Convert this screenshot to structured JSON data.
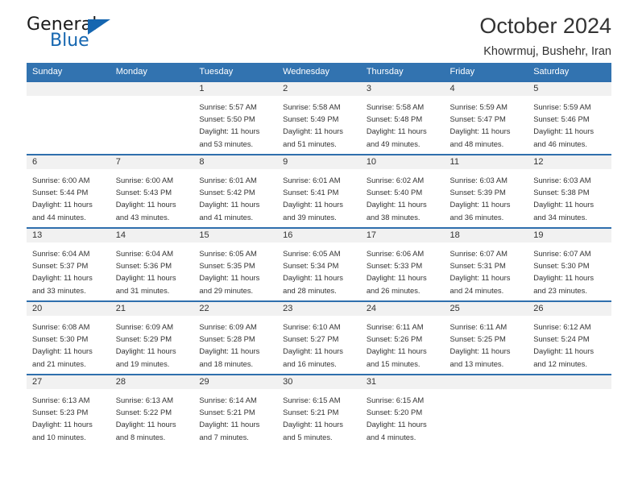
{
  "brand": {
    "name_top": "General",
    "name_bottom": "Blue",
    "triangle_color": "#1566b0"
  },
  "header": {
    "title": "October 2024",
    "subtitle": "Khowrmuj, Bushehr, Iran"
  },
  "theme": {
    "header_blue": "#3273b0",
    "row_border": "#2f6fad",
    "daynum_band": "#f1f1f1",
    "text": "#333333"
  },
  "calendar": {
    "weekday_headers": [
      "Sunday",
      "Monday",
      "Tuesday",
      "Wednesday",
      "Thursday",
      "Friday",
      "Saturday"
    ],
    "weeks": [
      [
        {
          "day": "",
          "sunrise": "",
          "sunset": "",
          "daylight1": "",
          "daylight2": "",
          "empty": true
        },
        {
          "day": "",
          "sunrise": "",
          "sunset": "",
          "daylight1": "",
          "daylight2": "",
          "empty": true
        },
        {
          "day": "1",
          "sunrise": "Sunrise: 5:57 AM",
          "sunset": "Sunset: 5:50 PM",
          "daylight1": "Daylight: 11 hours",
          "daylight2": "and 53 minutes.",
          "empty": false
        },
        {
          "day": "2",
          "sunrise": "Sunrise: 5:58 AM",
          "sunset": "Sunset: 5:49 PM",
          "daylight1": "Daylight: 11 hours",
          "daylight2": "and 51 minutes.",
          "empty": false
        },
        {
          "day": "3",
          "sunrise": "Sunrise: 5:58 AM",
          "sunset": "Sunset: 5:48 PM",
          "daylight1": "Daylight: 11 hours",
          "daylight2": "and 49 minutes.",
          "empty": false
        },
        {
          "day": "4",
          "sunrise": "Sunrise: 5:59 AM",
          "sunset": "Sunset: 5:47 PM",
          "daylight1": "Daylight: 11 hours",
          "daylight2": "and 48 minutes.",
          "empty": false
        },
        {
          "day": "5",
          "sunrise": "Sunrise: 5:59 AM",
          "sunset": "Sunset: 5:46 PM",
          "daylight1": "Daylight: 11 hours",
          "daylight2": "and 46 minutes.",
          "empty": false
        }
      ],
      [
        {
          "day": "6",
          "sunrise": "Sunrise: 6:00 AM",
          "sunset": "Sunset: 5:44 PM",
          "daylight1": "Daylight: 11 hours",
          "daylight2": "and 44 minutes.",
          "empty": false
        },
        {
          "day": "7",
          "sunrise": "Sunrise: 6:00 AM",
          "sunset": "Sunset: 5:43 PM",
          "daylight1": "Daylight: 11 hours",
          "daylight2": "and 43 minutes.",
          "empty": false
        },
        {
          "day": "8",
          "sunrise": "Sunrise: 6:01 AM",
          "sunset": "Sunset: 5:42 PM",
          "daylight1": "Daylight: 11 hours",
          "daylight2": "and 41 minutes.",
          "empty": false
        },
        {
          "day": "9",
          "sunrise": "Sunrise: 6:01 AM",
          "sunset": "Sunset: 5:41 PM",
          "daylight1": "Daylight: 11 hours",
          "daylight2": "and 39 minutes.",
          "empty": false
        },
        {
          "day": "10",
          "sunrise": "Sunrise: 6:02 AM",
          "sunset": "Sunset: 5:40 PM",
          "daylight1": "Daylight: 11 hours",
          "daylight2": "and 38 minutes.",
          "empty": false
        },
        {
          "day": "11",
          "sunrise": "Sunrise: 6:03 AM",
          "sunset": "Sunset: 5:39 PM",
          "daylight1": "Daylight: 11 hours",
          "daylight2": "and 36 minutes.",
          "empty": false
        },
        {
          "day": "12",
          "sunrise": "Sunrise: 6:03 AM",
          "sunset": "Sunset: 5:38 PM",
          "daylight1": "Daylight: 11 hours",
          "daylight2": "and 34 minutes.",
          "empty": false
        }
      ],
      [
        {
          "day": "13",
          "sunrise": "Sunrise: 6:04 AM",
          "sunset": "Sunset: 5:37 PM",
          "daylight1": "Daylight: 11 hours",
          "daylight2": "and 33 minutes.",
          "empty": false
        },
        {
          "day": "14",
          "sunrise": "Sunrise: 6:04 AM",
          "sunset": "Sunset: 5:36 PM",
          "daylight1": "Daylight: 11 hours",
          "daylight2": "and 31 minutes.",
          "empty": false
        },
        {
          "day": "15",
          "sunrise": "Sunrise: 6:05 AM",
          "sunset": "Sunset: 5:35 PM",
          "daylight1": "Daylight: 11 hours",
          "daylight2": "and 29 minutes.",
          "empty": false
        },
        {
          "day": "16",
          "sunrise": "Sunrise: 6:05 AM",
          "sunset": "Sunset: 5:34 PM",
          "daylight1": "Daylight: 11 hours",
          "daylight2": "and 28 minutes.",
          "empty": false
        },
        {
          "day": "17",
          "sunrise": "Sunrise: 6:06 AM",
          "sunset": "Sunset: 5:33 PM",
          "daylight1": "Daylight: 11 hours",
          "daylight2": "and 26 minutes.",
          "empty": false
        },
        {
          "day": "18",
          "sunrise": "Sunrise: 6:07 AM",
          "sunset": "Sunset: 5:31 PM",
          "daylight1": "Daylight: 11 hours",
          "daylight2": "and 24 minutes.",
          "empty": false
        },
        {
          "day": "19",
          "sunrise": "Sunrise: 6:07 AM",
          "sunset": "Sunset: 5:30 PM",
          "daylight1": "Daylight: 11 hours",
          "daylight2": "and 23 minutes.",
          "empty": false
        }
      ],
      [
        {
          "day": "20",
          "sunrise": "Sunrise: 6:08 AM",
          "sunset": "Sunset: 5:30 PM",
          "daylight1": "Daylight: 11 hours",
          "daylight2": "and 21 minutes.",
          "empty": false
        },
        {
          "day": "21",
          "sunrise": "Sunrise: 6:09 AM",
          "sunset": "Sunset: 5:29 PM",
          "daylight1": "Daylight: 11 hours",
          "daylight2": "and 19 minutes.",
          "empty": false
        },
        {
          "day": "22",
          "sunrise": "Sunrise: 6:09 AM",
          "sunset": "Sunset: 5:28 PM",
          "daylight1": "Daylight: 11 hours",
          "daylight2": "and 18 minutes.",
          "empty": false
        },
        {
          "day": "23",
          "sunrise": "Sunrise: 6:10 AM",
          "sunset": "Sunset: 5:27 PM",
          "daylight1": "Daylight: 11 hours",
          "daylight2": "and 16 minutes.",
          "empty": false
        },
        {
          "day": "24",
          "sunrise": "Sunrise: 6:11 AM",
          "sunset": "Sunset: 5:26 PM",
          "daylight1": "Daylight: 11 hours",
          "daylight2": "and 15 minutes.",
          "empty": false
        },
        {
          "day": "25",
          "sunrise": "Sunrise: 6:11 AM",
          "sunset": "Sunset: 5:25 PM",
          "daylight1": "Daylight: 11 hours",
          "daylight2": "and 13 minutes.",
          "empty": false
        },
        {
          "day": "26",
          "sunrise": "Sunrise: 6:12 AM",
          "sunset": "Sunset: 5:24 PM",
          "daylight1": "Daylight: 11 hours",
          "daylight2": "and 12 minutes.",
          "empty": false
        }
      ],
      [
        {
          "day": "27",
          "sunrise": "Sunrise: 6:13 AM",
          "sunset": "Sunset: 5:23 PM",
          "daylight1": "Daylight: 11 hours",
          "daylight2": "and 10 minutes.",
          "empty": false
        },
        {
          "day": "28",
          "sunrise": "Sunrise: 6:13 AM",
          "sunset": "Sunset: 5:22 PM",
          "daylight1": "Daylight: 11 hours",
          "daylight2": "and 8 minutes.",
          "empty": false
        },
        {
          "day": "29",
          "sunrise": "Sunrise: 6:14 AM",
          "sunset": "Sunset: 5:21 PM",
          "daylight1": "Daylight: 11 hours",
          "daylight2": "and 7 minutes.",
          "empty": false
        },
        {
          "day": "30",
          "sunrise": "Sunrise: 6:15 AM",
          "sunset": "Sunset: 5:21 PM",
          "daylight1": "Daylight: 11 hours",
          "daylight2": "and 5 minutes.",
          "empty": false
        },
        {
          "day": "31",
          "sunrise": "Sunrise: 6:15 AM",
          "sunset": "Sunset: 5:20 PM",
          "daylight1": "Daylight: 11 hours",
          "daylight2": "and 4 minutes.",
          "empty": false
        },
        {
          "day": "",
          "sunrise": "",
          "sunset": "",
          "daylight1": "",
          "daylight2": "",
          "empty": true
        },
        {
          "day": "",
          "sunrise": "",
          "sunset": "",
          "daylight1": "",
          "daylight2": "",
          "empty": true
        }
      ]
    ]
  }
}
